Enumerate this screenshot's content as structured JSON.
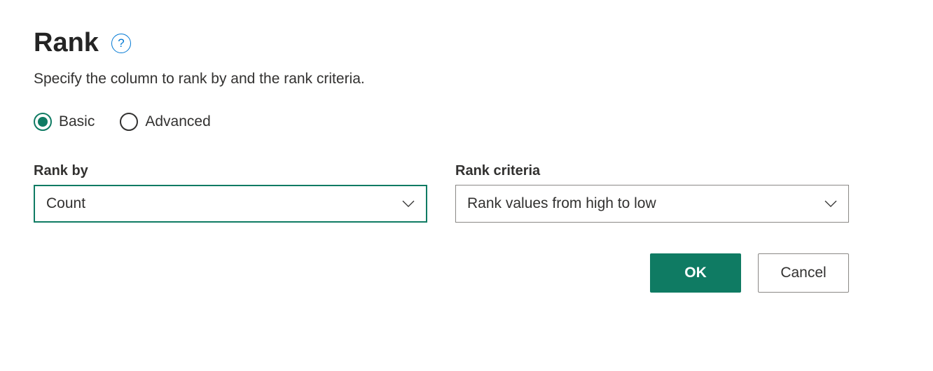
{
  "header": {
    "title": "Rank",
    "help_label": "?"
  },
  "subtitle": "Specify the column to rank by and the rank criteria.",
  "mode": {
    "basic_label": "Basic",
    "advanced_label": "Advanced",
    "selected": "basic"
  },
  "fields": {
    "rank_by": {
      "label": "Rank by",
      "value": "Count"
    },
    "rank_criteria": {
      "label": "Rank criteria",
      "value": "Rank values from high to low"
    }
  },
  "buttons": {
    "ok": "OK",
    "cancel": "Cancel"
  },
  "colors": {
    "accent": "#0f7b63",
    "link": "#0078d4"
  }
}
